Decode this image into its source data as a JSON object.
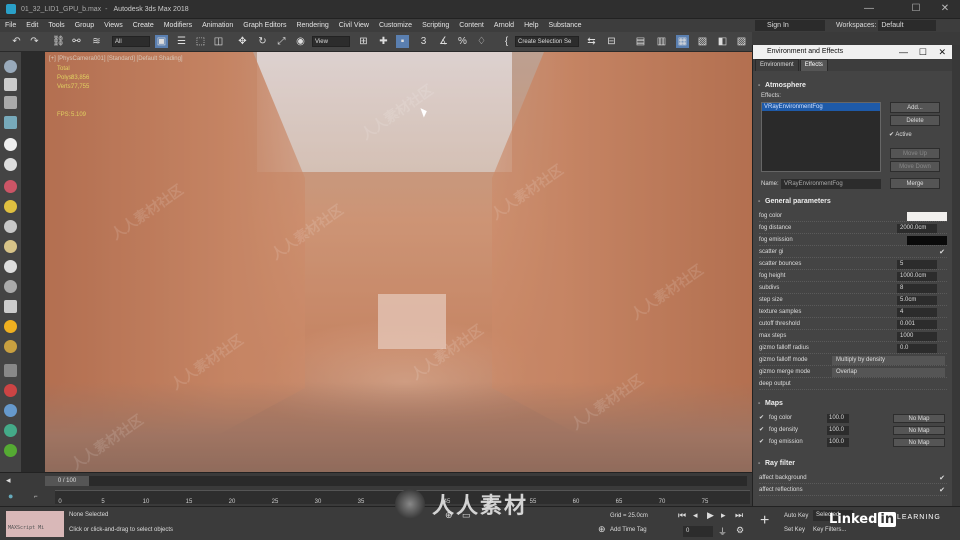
{
  "window": {
    "title": "Autodesk 3ds Max 2018",
    "file": "01_32_LID1_GPU_b.max",
    "minimize": "—",
    "maximize": "☐",
    "close": "✕"
  },
  "menu": [
    "File",
    "Edit",
    "Tools",
    "Group",
    "Views",
    "Create",
    "Modifiers",
    "Animation",
    "Graph Editors",
    "Rendering",
    "Civil View",
    "Customize",
    "Scripting",
    "Content",
    "Arnold",
    "Help",
    "Substance"
  ],
  "signin": "Sign In",
  "workspaces": {
    "label": "Workspaces:",
    "value": "Default"
  },
  "toolbar": {
    "filter": "All",
    "view": "View",
    "selection_set": "Create Selection Se"
  },
  "viewport": {
    "label": "[+] [PhysCamera001] [Standard] [Default Shading]",
    "stats": [
      {
        "key": "Total",
        "value": ""
      },
      {
        "key": "Polys:",
        "value": "83,856"
      },
      {
        "key": "Verts:",
        "value": "77,755"
      },
      {
        "key": "FPS:",
        "value": "5.109"
      }
    ]
  },
  "watermarks": [
    "人人素材社区",
    "人人素材社区",
    "人人素材社区",
    "人人素材社区",
    "人人素材社区",
    "人人素材社区",
    "人人素材社区",
    "人人素材社区",
    "人人素材社区"
  ],
  "timeline": {
    "frame": "0 / 100",
    "ticks": [
      "0",
      "5",
      "10",
      "15",
      "20",
      "25",
      "30",
      "35",
      "40",
      "45",
      "50",
      "55",
      "60",
      "65",
      "70",
      "75"
    ]
  },
  "status": {
    "maxscript": "MAXScript Mi",
    "selection": "None Selected",
    "prompt": "Click or click-and-drag to select objects",
    "grid": "Grid = 25.0cm",
    "add_time_tag": "Add Time Tag",
    "auto_key": "Auto Key",
    "set_key": "Set Key",
    "selected": "Selected",
    "key_filters": "Key Filters...",
    "frame_num": "0"
  },
  "overlay": {
    "logo_text": "人人素材",
    "linkedin": "Linked",
    "linkedin_in": "in",
    "learning": "LEARNING"
  },
  "panel": {
    "title": "Environment and Effects",
    "tabs": [
      "Environment",
      "Effects"
    ],
    "atmosphere": {
      "heading": "Atmosphere",
      "effects_label": "Effects:",
      "effects": [
        "VRayEnvironmentFog"
      ],
      "buttons": {
        "add": "Add...",
        "delete": "Delete",
        "active": "Active",
        "move_up": "Move Up",
        "move_down": "Move Down",
        "merge": "Merge"
      },
      "name_label": "Name:",
      "name_value": "VRayEnvironmentFog"
    },
    "general": {
      "heading": "General parameters",
      "rows": [
        {
          "label": "fog color",
          "type": "swatch",
          "color": "#f2f0ee"
        },
        {
          "label": "fog distance",
          "type": "value",
          "value": "2000.0cm"
        },
        {
          "label": "fog emission",
          "type": "swatch",
          "color": "#0a0a0a"
        },
        {
          "label": "scatter gi",
          "type": "check",
          "value": "✔"
        },
        {
          "label": "scatter bounces",
          "type": "value",
          "value": "5"
        },
        {
          "label": "fog height",
          "type": "value",
          "value": "1000.0cm"
        },
        {
          "label": "subdivs",
          "type": "value",
          "value": "8"
        },
        {
          "label": "step size",
          "type": "value",
          "value": "5.0cm"
        },
        {
          "label": "texture samples",
          "type": "value",
          "value": "4"
        },
        {
          "label": "cutoff threshold",
          "type": "value",
          "value": "0.001"
        },
        {
          "label": "max steps",
          "type": "value",
          "value": "1000"
        },
        {
          "label": "gizmo falloff radius",
          "type": "value",
          "value": "0.0"
        },
        {
          "label": "gizmo falloff mode",
          "type": "dropdown",
          "value": "Multiply by density"
        },
        {
          "label": "gizmo merge mode",
          "type": "dropdown",
          "value": "Overlap"
        },
        {
          "label": "deep output",
          "type": "check",
          "value": ""
        }
      ]
    },
    "maps": {
      "heading": "Maps",
      "rows": [
        {
          "label": "fog color",
          "amount": "100.0",
          "map": "No Map"
        },
        {
          "label": "fog density",
          "amount": "100.0",
          "map": "No Map"
        },
        {
          "label": "fog emission",
          "amount": "100.0",
          "map": "No Map"
        }
      ]
    },
    "rayfilter": {
      "heading": "Ray filter",
      "rows": [
        {
          "label": "affect background",
          "value": "✔"
        },
        {
          "label": "affect reflections",
          "value": "✔"
        }
      ]
    }
  }
}
